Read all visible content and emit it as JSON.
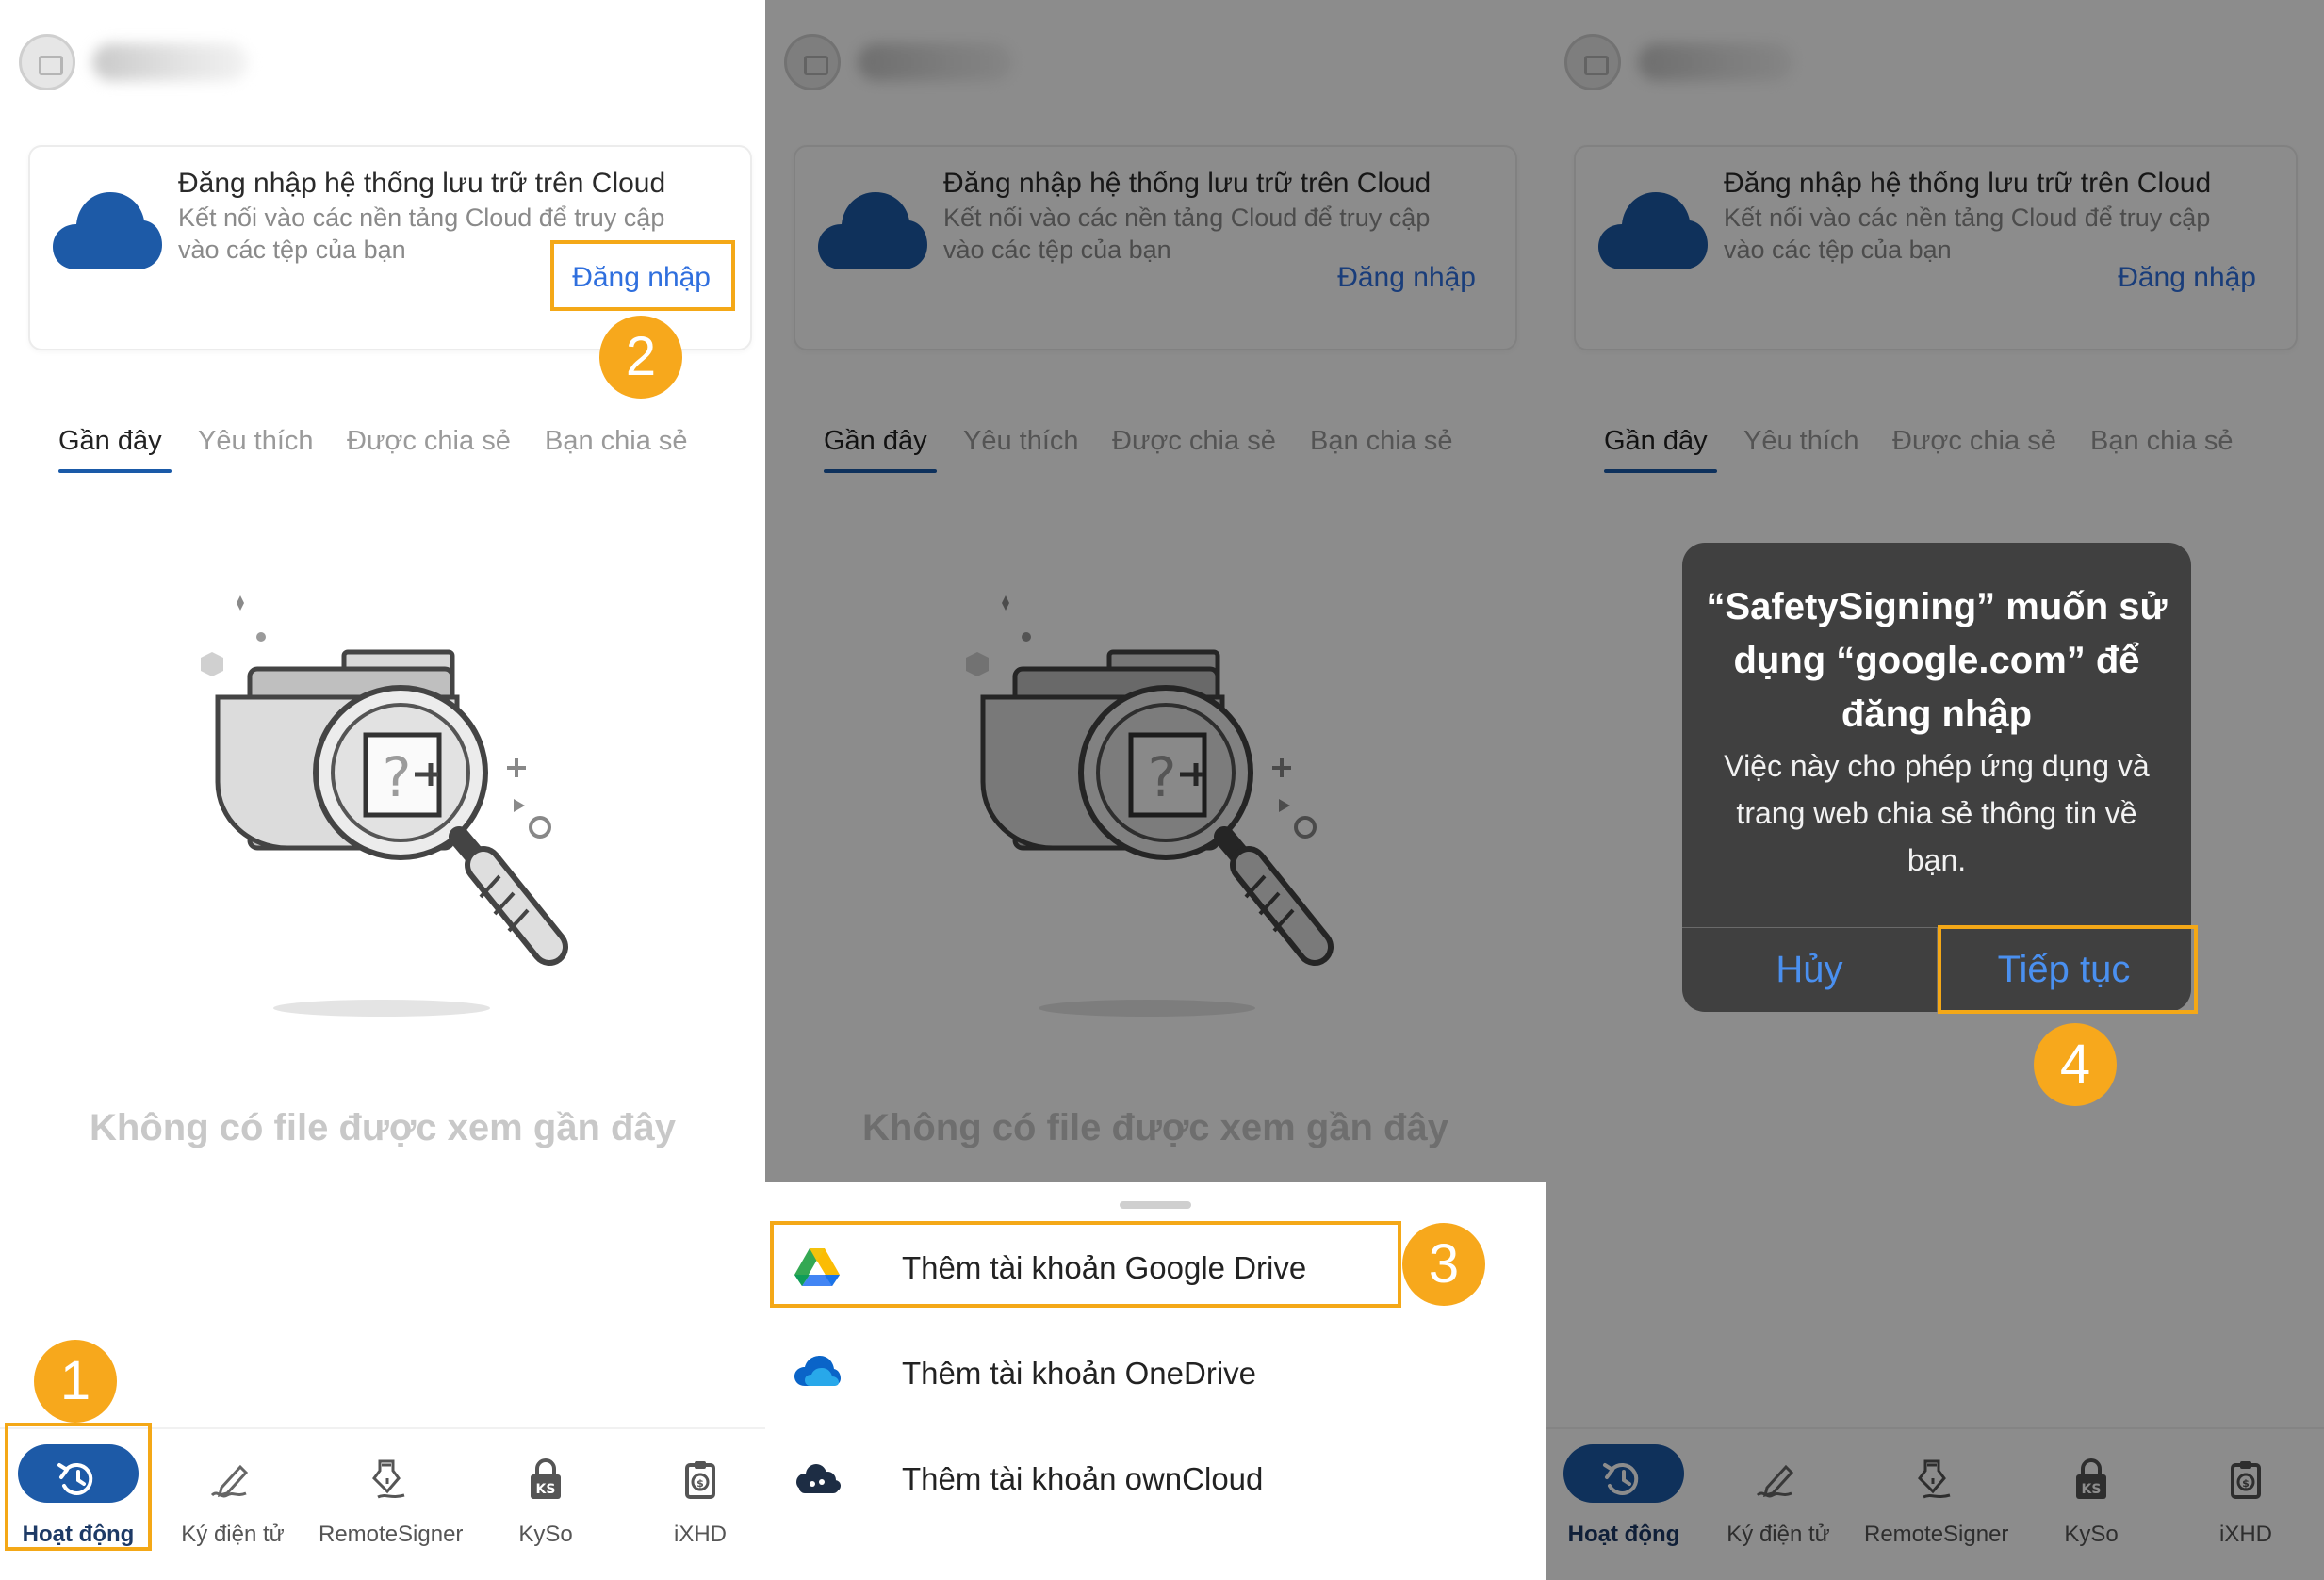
{
  "colors": {
    "accent": "#2f6fde",
    "nav_active": "#1d5aa7",
    "highlight": "#f4a817",
    "step_badge": "#f7a81c"
  },
  "cloud_card": {
    "title": "Đăng nhập hệ thống lưu trữ trên Cloud",
    "description": "Kết nối vào các nền tảng Cloud để truy cập vào các tệp của bạn",
    "login_label": "Đăng nhập",
    "icon": "cloud-icon"
  },
  "tabs": [
    {
      "label": "Gần đây",
      "active": true
    },
    {
      "label": "Yêu thích"
    },
    {
      "label": "Được chia sẻ"
    },
    {
      "label": "Bạn chia sẻ"
    }
  ],
  "empty_state": {
    "message": "Không có file được xem gần đây",
    "icon": "folder-search-icon"
  },
  "bottom_nav": [
    {
      "label": "Hoạt động",
      "icon": "history-icon",
      "active": true
    },
    {
      "label": "Ký điện tử",
      "icon": "signature-pen-icon"
    },
    {
      "label": "RemoteSigner",
      "icon": "remote-sign-icon"
    },
    {
      "label": "KySo",
      "icon": "ks-lock-icon"
    },
    {
      "label": "iXHD",
      "icon": "invoice-icon"
    }
  ],
  "sheet": {
    "items": [
      {
        "label": "Thêm tài khoản Google Drive",
        "icon": "google-drive-icon"
      },
      {
        "label": "Thêm tài khoản OneDrive",
        "icon": "onedrive-icon"
      },
      {
        "label": "Thêm tài khoản ownCloud",
        "icon": "owncloud-icon"
      }
    ]
  },
  "alert": {
    "title": "“SafetySigning” muốn sử dụng “google.com” để đăng nhập",
    "message": "Việc này cho phép ứng dụng và trang web chia sẻ thông tin về bạn.",
    "cancel": "Hủy",
    "continue": "Tiếp tục"
  },
  "steps": [
    "1",
    "2",
    "3",
    "4"
  ]
}
